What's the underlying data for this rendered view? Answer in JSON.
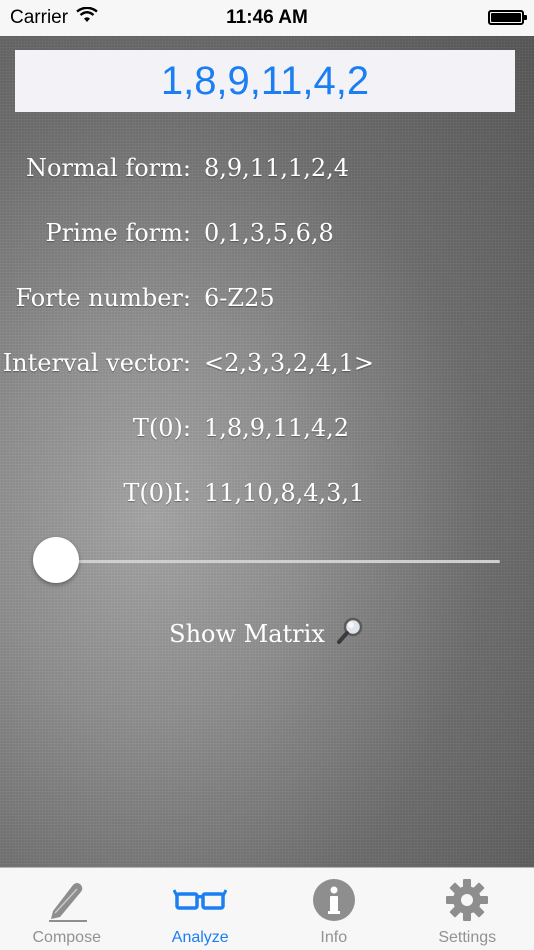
{
  "status_bar": {
    "carrier": "Carrier",
    "time": "11:46 AM"
  },
  "input": {
    "value": "1,8,9,11,4,2"
  },
  "analysis": [
    {
      "label": "Normal form:",
      "value": "8,9,11,1,2,4"
    },
    {
      "label": "Prime form:",
      "value": "0,1,3,5,6,8"
    },
    {
      "label": "Forte number:",
      "value": "6-Z25"
    },
    {
      "label": "Interval vector:",
      "value": "<2,3,3,2,4,1>"
    },
    {
      "label": "T(0):",
      "value": "1,8,9,11,4,2"
    },
    {
      "label": "T(0)I:",
      "value": "11,10,8,4,3,1"
    }
  ],
  "slider": {
    "value": 0
  },
  "show_matrix": {
    "label": "Show Matrix",
    "icon": "magnifier-icon"
  },
  "tabs": [
    {
      "label": "Compose",
      "icon": "pen-icon"
    },
    {
      "label": "Analyze",
      "icon": "glasses-icon",
      "active": true
    },
    {
      "label": "Info",
      "icon": "info-icon"
    },
    {
      "label": "Settings",
      "icon": "gear-icon"
    }
  ],
  "colors": {
    "accent": "#1b7ef2",
    "tab_inactive": "#929292"
  }
}
